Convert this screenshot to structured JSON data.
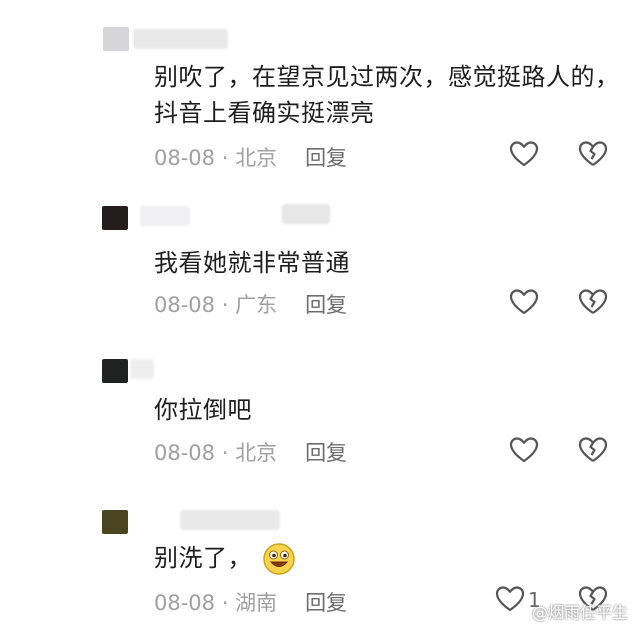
{
  "comments": [
    {
      "text_lines": [
        "别吹了，在望京见过两次，感觉挺路人的，",
        "抖音上看确实挺漂亮"
      ],
      "date": "08-08",
      "location": "北京",
      "reply": "回复",
      "likes": ""
    },
    {
      "text_lines": [
        "我看她就非常普通"
      ],
      "date": "08-08",
      "location": "广东",
      "reply": "回复",
      "likes": ""
    },
    {
      "text_lines": [
        "你拉倒吧"
      ],
      "date": "08-08",
      "location": "北京",
      "reply": "回复",
      "likes": ""
    },
    {
      "text_lines": [
        "别洗了，"
      ],
      "date": "08-08",
      "location": "湖南",
      "reply": "回复",
      "likes": "1"
    }
  ],
  "icons": {
    "like": "heart-outline-icon",
    "dislike": "broken-heart-icon",
    "emoji": "grinning-face-emoji"
  },
  "watermark": "@烟雨任平生",
  "colors": {
    "text": "#1e1e1e",
    "meta": "#a0a0a0",
    "icon": "#555555"
  }
}
